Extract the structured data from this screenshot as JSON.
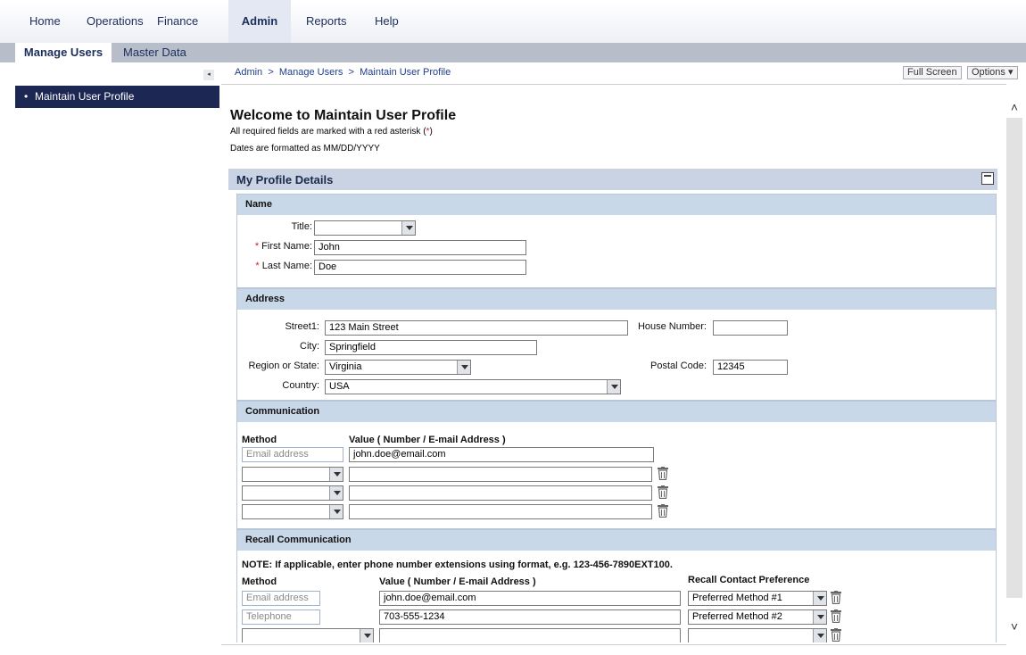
{
  "topnav": {
    "tabs": [
      {
        "label": "Home"
      },
      {
        "label": "Operations"
      },
      {
        "label": "Finance"
      },
      {
        "label": "Admin"
      },
      {
        "label": "Reports"
      },
      {
        "label": "Help"
      }
    ],
    "active": "Admin"
  },
  "subnav": {
    "tabs": [
      {
        "label": "Manage Users"
      },
      {
        "label": "Master Data"
      }
    ]
  },
  "leftnav": {
    "items": [
      {
        "label": "Maintain User Profile"
      }
    ]
  },
  "breadcrumb": {
    "items": [
      "Admin",
      "Manage Users",
      "Maintain User Profile"
    ],
    "separator": ">"
  },
  "toolbar": {
    "fullscreen": "Full Screen",
    "options": "Options ▾"
  },
  "page": {
    "title": "Welcome to Maintain User Profile",
    "note_required_prefix": "All required fields are marked with a red asterisk (",
    "note_required_ast": "*",
    "note_required_suffix": ")",
    "note_dates": "Dates are formatted as MM/DD/YYYY"
  },
  "panel": {
    "title": "My Profile Details"
  },
  "name_section": {
    "heading": "Name",
    "title_label": "Title:",
    "title_value": "",
    "first_name_label": "First Name:",
    "first_name_value": "John",
    "last_name_label": "Last Name:",
    "last_name_value": "Doe",
    "required_marker": "*"
  },
  "address_section": {
    "heading": "Address",
    "street_label": "Street1:",
    "street_value": "123 Main Street",
    "house_label": "House Number:",
    "house_value": "",
    "city_label": "City:",
    "city_value": "Springfield",
    "region_label": "Region or State:",
    "region_value": "Virginia",
    "postal_label": "Postal Code:",
    "postal_value": "12345",
    "country_label": "Country:",
    "country_value": "USA"
  },
  "communication_section": {
    "heading": "Communication",
    "col_method": "Method",
    "col_value": "Value ( Number / E-mail Address )",
    "rows": [
      {
        "method": "Email address",
        "value": "john.doe@email.com"
      },
      {
        "method": "",
        "value": ""
      },
      {
        "method": "",
        "value": ""
      },
      {
        "method": "",
        "value": ""
      }
    ]
  },
  "recall_section": {
    "heading": "Recall Communication",
    "note": "NOTE: If applicable, enter phone number extensions using format, e.g. 123-456-7890EXT100.",
    "col_method": "Method",
    "col_value": "Value ( Number / E-mail Address )",
    "col_pref": "Recall Contact Preference",
    "rows": [
      {
        "method": "Email address",
        "value": "john.doe@email.com",
        "pref": "Preferred Method #1"
      },
      {
        "method": "Telephone",
        "value": "703-555-1234",
        "pref": "Preferred Method #2"
      },
      {
        "method": "",
        "value": "",
        "pref": ""
      }
    ]
  },
  "icons": {
    "trash": "trash-icon",
    "scroll_up": "chevron-up-icon",
    "scroll_down": "chevron-down-icon",
    "collapse": "collapse-left-icon",
    "minimize": "minimize-icon"
  },
  "colors": {
    "nav_dark": "#1c2754",
    "section_header": "#c9d8e8",
    "required": "#d02020",
    "link": "#1f3f8c"
  }
}
